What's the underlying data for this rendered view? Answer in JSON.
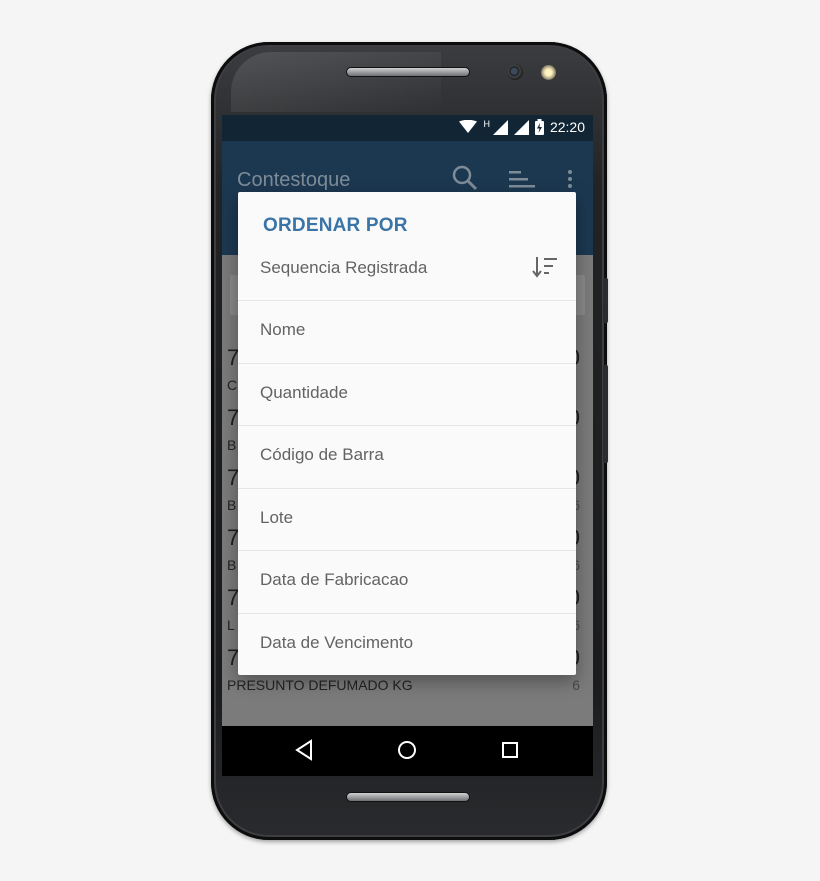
{
  "status_bar": {
    "time": "22:20",
    "network_label": "H",
    "icons": [
      "wifi-icon",
      "signal-icon",
      "signal-icon",
      "battery-charging-icon"
    ]
  },
  "app_bar": {
    "title": "Contestoque",
    "icons": [
      "search-icon",
      "sort-icon",
      "more-vert-icon"
    ]
  },
  "list": {
    "rows": [
      {
        "number": "7",
        "name": "C",
        "value": "0",
        "qty": ""
      },
      {
        "number": "7",
        "name": "B",
        "value": "0",
        "qty": ""
      },
      {
        "number": "7",
        "name": "B",
        "value": "0",
        "qty": "6"
      },
      {
        "number": "7",
        "name": "B",
        "value": "0",
        "qty": "6"
      },
      {
        "number": "7",
        "name": "L",
        "value": "0",
        "qty": "6"
      },
      {
        "number": "7",
        "name": "PRESUNTO DEFUMADO KG",
        "value": "0",
        "qty": "6"
      }
    ],
    "fab_symbol": "+"
  },
  "dialog": {
    "title": "ORDENAR POR",
    "selected_sort_icon": "sort-ascending-icon",
    "options": [
      {
        "label": "Sequencia Registrada"
      },
      {
        "label": "Nome"
      },
      {
        "label": "Quantidade"
      },
      {
        "label": "Código de Barra"
      },
      {
        "label": "Lote"
      },
      {
        "label": "Data de Fabricacao"
      },
      {
        "label": "Data de Vencimento"
      }
    ]
  },
  "nav_bar": {
    "icons": [
      "back-icon",
      "home-icon",
      "recents-icon"
    ]
  },
  "colors": {
    "status_bar": "#112535",
    "app_bar": "#1c3851",
    "dialog_title": "#3b74a6",
    "dialog_bg": "#fafafa",
    "option_text": "#636363"
  }
}
